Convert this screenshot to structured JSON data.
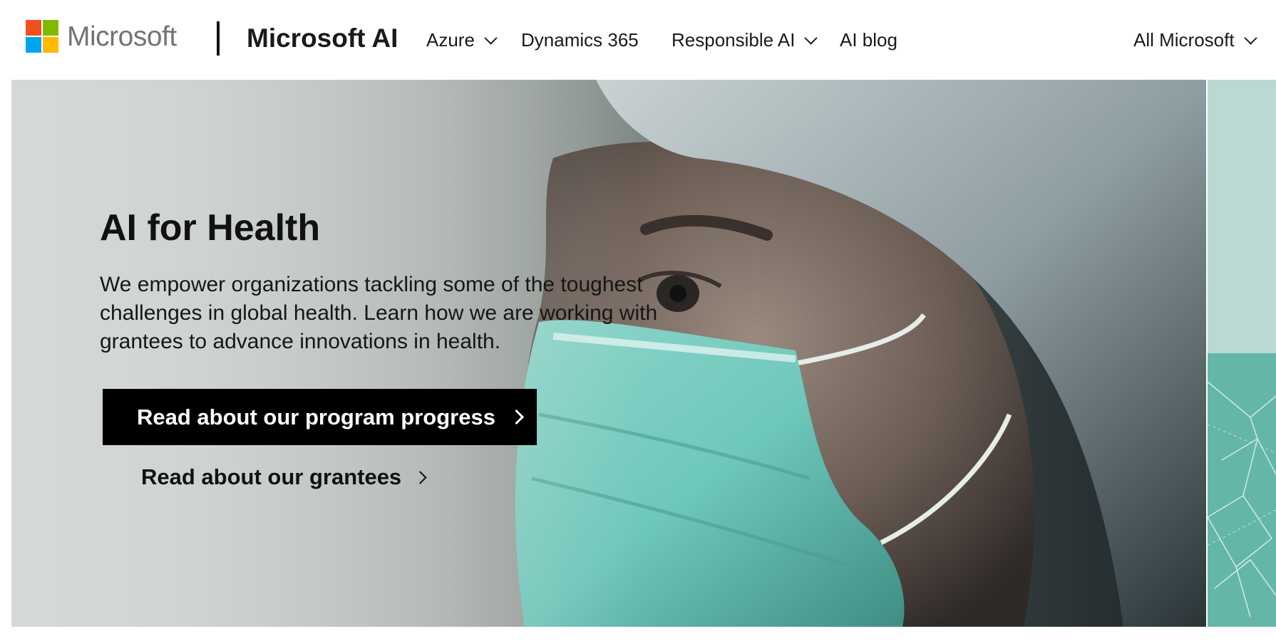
{
  "header": {
    "logo": {
      "wordmark": "Microsoft",
      "colors": [
        "#f25022",
        "#7fba00",
        "#00a4ef",
        "#ffb900"
      ]
    },
    "brand": "Microsoft AI",
    "nav": [
      {
        "label": "Azure",
        "has_dropdown": true
      },
      {
        "label": "Dynamics 365",
        "has_dropdown": false
      },
      {
        "label": "Responsible AI",
        "has_dropdown": true
      },
      {
        "label": "AI blog",
        "has_dropdown": false
      }
    ],
    "all_microsoft": {
      "label": "All Microsoft",
      "has_dropdown": true
    }
  },
  "hero": {
    "title": "AI for Health",
    "description": "We empower organizations tackling some of the toughest challenges in global health. Learn how we are working with grantees to advance innovations in health.",
    "primary_cta": "Read about our program progress",
    "secondary_cta": "Read about our grantees",
    "image_subject": "healthcare worker in surgical mask and head covering"
  },
  "icons": {
    "dropdown": "chevron-down-icon",
    "cta": "chevron-right-icon"
  },
  "colors": {
    "cta_background": "#000000",
    "cta_text": "#ffffff",
    "mask_teal": "#6ec8bb",
    "side_panel_teal": "#64b6a9"
  }
}
